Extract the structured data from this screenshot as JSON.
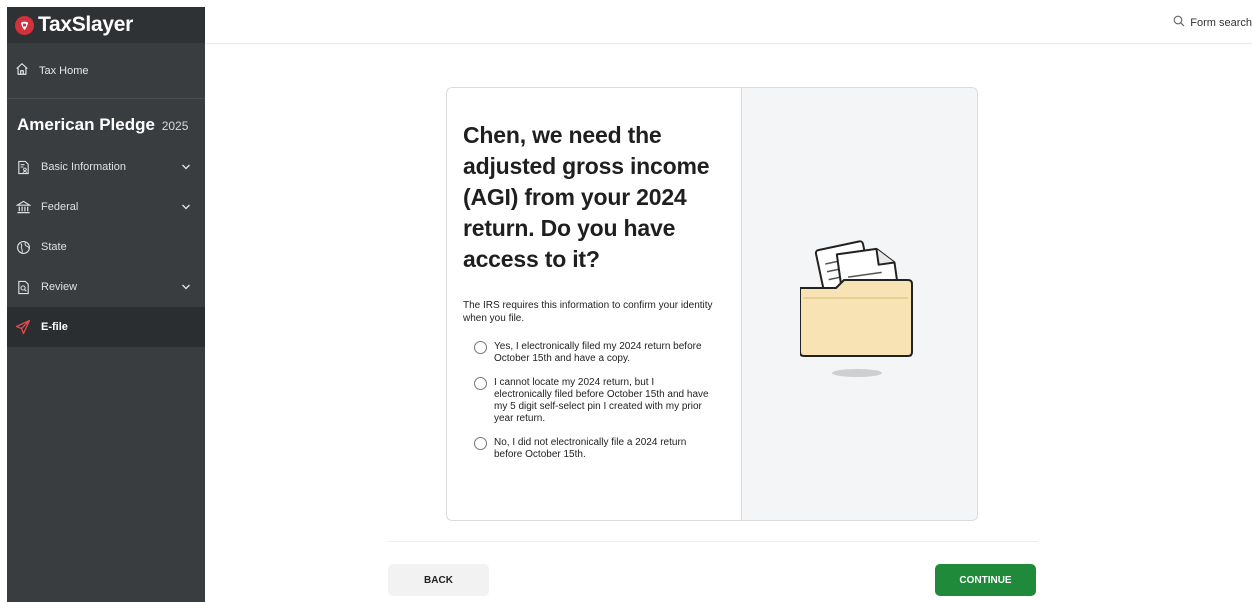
{
  "brand": {
    "name": "TaxSlayer",
    "accent": "#d3313b"
  },
  "sidebar": {
    "home_label": "Tax Home",
    "return_title": "American Pledge",
    "return_year": "2025",
    "items": [
      {
        "label": "Basic Information",
        "icon": "document-person-icon",
        "expandable": true
      },
      {
        "label": "Federal",
        "icon": "bank-icon",
        "expandable": true
      },
      {
        "label": "State",
        "icon": "globe-icon",
        "expandable": false
      },
      {
        "label": "Review",
        "icon": "document-search-icon",
        "expandable": true
      },
      {
        "label": "E-file",
        "icon": "paper-plane-icon",
        "expandable": false,
        "active": true
      }
    ]
  },
  "topbar": {
    "search_label": "Form search"
  },
  "card": {
    "question": "Chen, we need the adjusted gross income (AGI) from your 2024 return. Do you have access to it?",
    "subtext": "The IRS requires this information to confirm your identity when you file.",
    "options": [
      "Yes, I electronically filed my 2024 return before October 15th and have a copy.",
      "I cannot locate my 2024 return, but I electronically filed before October 15th and have my 5 digit self-select pin I created with my prior year return.",
      "No, I did not electronically file a 2024 return before October 15th."
    ]
  },
  "footer": {
    "back_label": "BACK",
    "continue_label": "CONTINUE"
  },
  "colors": {
    "sidebar_bg": "#3a3d40",
    "continue_green": "#1e8a3a",
    "efile_red": "#e04a4a"
  }
}
